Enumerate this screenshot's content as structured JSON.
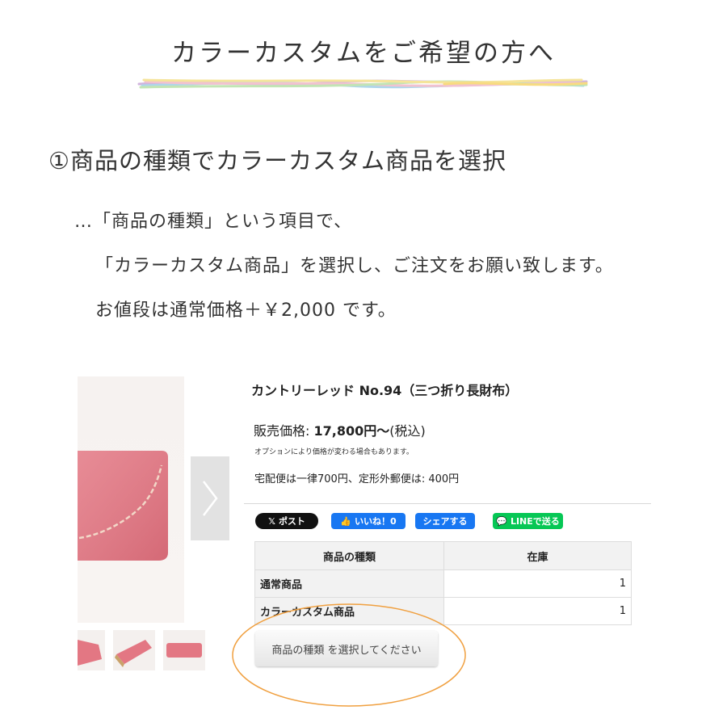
{
  "heading": "カラーカスタムをご希望の方へ",
  "step": "①商品の種類でカラーカスタム商品を選択",
  "instructions": [
    "…「商品の種類」という項目で、",
    "「カラーカスタム商品」を選択し、ご注文をお願い致します。",
    "お値段は通常価格＋￥2,000 です。"
  ],
  "product": {
    "name": "カントリーレッド No.94（三つ折り長財布）",
    "price_label": "販売価格: ",
    "price_value": "17,800円〜",
    "price_tax": "(税込)",
    "option_note": "オプションにより価格が変わる場合もあります。",
    "shipping": "宅配便は一律700円、定形外郵便は: 400円"
  },
  "social": {
    "x_post": "ポスト",
    "like": "いいね！0",
    "share": "シェアする",
    "line": "LINEで送る"
  },
  "stock_table": {
    "headers": [
      "商品の種類",
      "在庫"
    ],
    "rows": [
      {
        "name": "通常商品",
        "qty": "1"
      },
      {
        "name": "カラーカスタム商品",
        "qty": "1"
      }
    ]
  },
  "select_button": "商品の種類 を選択してください",
  "colors": {
    "leather": "#e5707a",
    "highlight": "#f0a040",
    "facebook": "#1877f2",
    "line": "#06c755"
  }
}
